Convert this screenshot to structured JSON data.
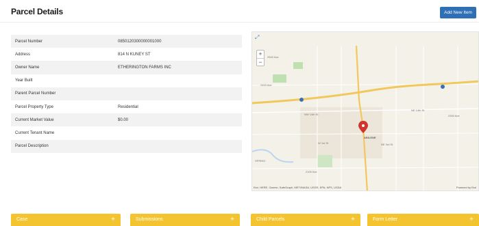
{
  "header": {
    "title": "Parcel Details",
    "add_label": "Add New Item"
  },
  "details": [
    {
      "key": "Parcel Number",
      "value": "0850120300000001000"
    },
    {
      "key": "Address",
      "value": "814 N KUNEY ST"
    },
    {
      "key": "Owner Name",
      "value": "ETHERINGTON FARMS INC"
    },
    {
      "key": "Year Built",
      "value": ""
    },
    {
      "key": "Parent Parcel Number",
      "value": ""
    },
    {
      "key": "Parcel Property Type",
      "value": "Residential"
    },
    {
      "key": "Current Market Value",
      "value": "$0.00"
    },
    {
      "key": "Current Tenant Name",
      "value": ""
    },
    {
      "key": "Parcel Description",
      "value": ""
    }
  ],
  "map": {
    "attribution": "Esri, HERE, Garmin, SafeGraph, METI/NASA, USGS, EPA, NPS, USDA",
    "powered": "Powered by Esri",
    "labels": {
      "label_2500": "2500 Ave",
      "label_2400": "2400 Ave",
      "label_nw14": "NW 14th St",
      "label_ne14": "NE 14th St",
      "label_abilene": "ABILENE",
      "label_spring": "SPRING",
      "label_2100": "2100 Ave",
      "label_w1st": "W 1st St",
      "label_ne3rd": "NE 3rd St",
      "label_2300": "2300 Ave"
    }
  },
  "tabs": [
    {
      "label": "Case"
    },
    {
      "label": "Submissions"
    },
    {
      "label": "Child Parcels"
    },
    {
      "label": "Form Letter"
    }
  ],
  "colors": {
    "accent_button": "#2f6fb6",
    "tab_yellow": "#f4c430",
    "marker_red": "#d0342c",
    "highway": "#f2c75c"
  }
}
